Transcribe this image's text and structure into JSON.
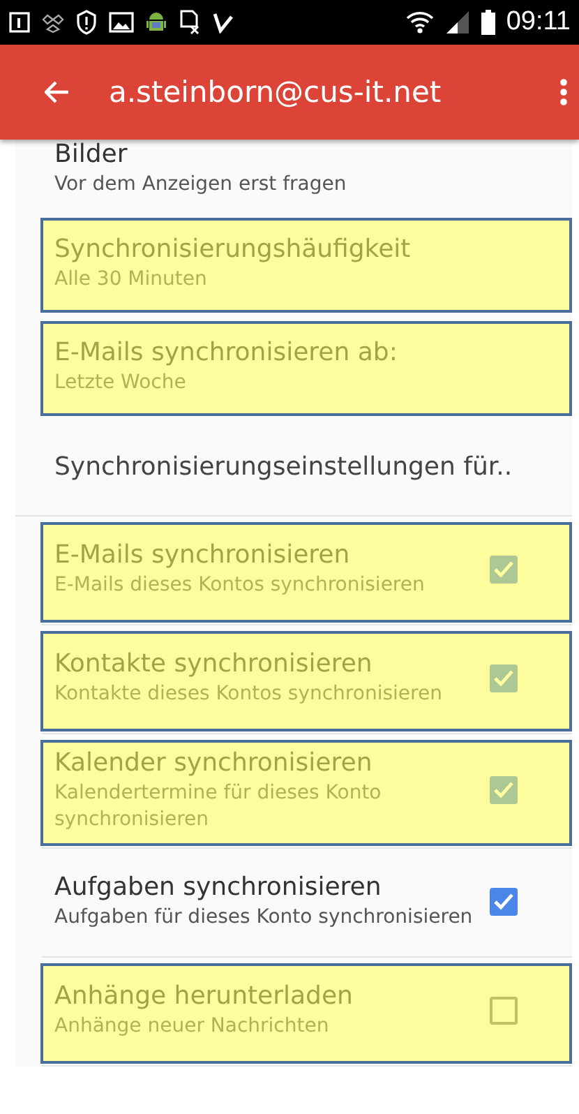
{
  "status_bar": {
    "time": "09:11"
  },
  "app_bar": {
    "title": "a.steinborn@cus-it.net"
  },
  "settings": [
    {
      "kind": "text",
      "title": "Bilder",
      "summary": "Vor dem Anzeigen erst fragen",
      "highlighted": false
    },
    {
      "kind": "text",
      "title": "Synchronisierungshäufigkeit",
      "summary": "Alle 30 Minuten",
      "highlighted": true
    },
    {
      "kind": "text",
      "title": "E-Mails synchronisieren ab:",
      "summary": "Letzte Woche",
      "highlighted": true
    },
    {
      "kind": "header",
      "title": "Synchronisierungseinstellungen für..",
      "highlighted": false
    },
    {
      "kind": "checkbox",
      "title": "E-Mails synchronisieren",
      "summary": "E-Mails dieses Kontos synchronisieren",
      "checked": true,
      "highlighted": true
    },
    {
      "kind": "checkbox",
      "title": "Kontakte synchronisieren",
      "summary": "Kontakte dieses Kontos synchronisieren",
      "checked": true,
      "highlighted": true
    },
    {
      "kind": "checkbox",
      "title": "Kalender synchronisieren",
      "summary": "Kalendertermine für dieses Konto synchronisieren",
      "checked": true,
      "highlighted": true
    },
    {
      "kind": "checkbox",
      "title": "Aufgaben synchronisieren",
      "summary": "Aufgaben für dieses Konto synchronisieren",
      "checked": true,
      "highlighted": false
    },
    {
      "kind": "checkbox",
      "title": "Anhänge herunterladen",
      "summary": "Anhänge neuer Nachrichten",
      "checked": false,
      "highlighted": true
    }
  ]
}
